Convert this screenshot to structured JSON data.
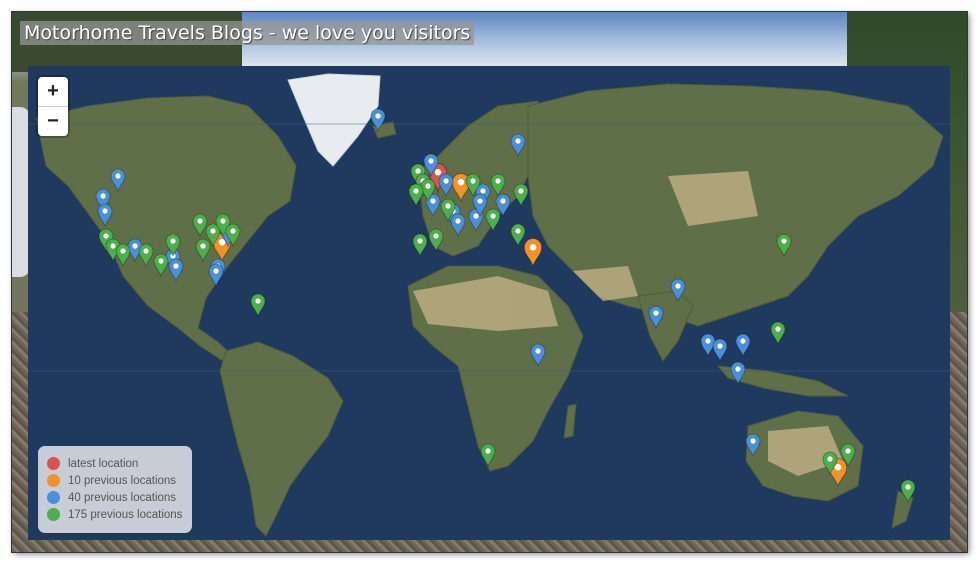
{
  "page": {
    "title": "Motorhome Travels Blogs - we love you visitors"
  },
  "map": {
    "zoom_in_label": "+",
    "zoom_out_label": "−",
    "ocean_color": "#1f3a5e"
  },
  "legend": {
    "items": [
      {
        "label": "latest location",
        "color": "#d9534f"
      },
      {
        "label": "10 previous locations",
        "color": "#f0922b"
      },
      {
        "label": "40 previous locations",
        "color": "#4a90d9"
      },
      {
        "label": "175 previous locations",
        "color": "#4cae4c"
      }
    ]
  },
  "icons": {
    "zoom_in": "plus-icon",
    "zoom_out": "minus-icon",
    "marker": "map-marker-icon"
  }
}
